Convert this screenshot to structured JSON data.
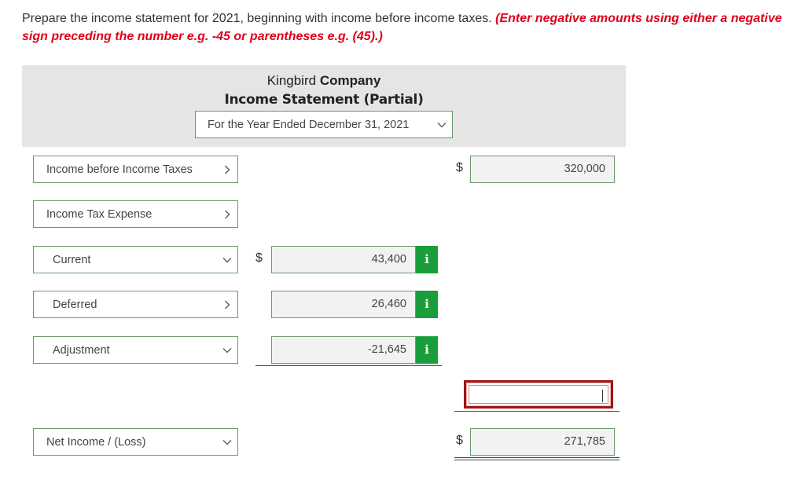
{
  "instructions": {
    "text": "Prepare the income statement for 2021, beginning with income before income taxes. ",
    "note": "(Enter negative amounts using either a negative sign preceding the number e.g. -45 or parentheses e.g. (45).)"
  },
  "header": {
    "company_plain": "Kingbird ",
    "company_bold": "Company",
    "statement_title": "Income Statement (Partial)",
    "period": "For the Year Ended December 31, 2021"
  },
  "rows": {
    "income_before_taxes": {
      "label": "Income before Income Taxes",
      "dollar": "$",
      "amount": "320,000"
    },
    "income_tax_expense": {
      "label": "Income Tax Expense"
    },
    "current": {
      "label": "Current",
      "dollar": "$",
      "amount": "43,400",
      "info": "i"
    },
    "deferred": {
      "label": "Deferred",
      "amount": "26,460",
      "info": "i"
    },
    "adjustment": {
      "label": "Adjustment",
      "amount": "-21,645",
      "info": "i"
    },
    "total_tax": {
      "amount": ""
    },
    "net_income": {
      "label": "Net Income / (Loss)",
      "dollar": "$",
      "amount": "271,785"
    }
  },
  "colors": {
    "accent_green": "#1a9e3c",
    "note_red": "#e0001b",
    "field_border": "#6b9a6b",
    "active_border": "#a01414"
  },
  "icons": {
    "dropdown": "chevron-down-icon",
    "info": "info-icon"
  }
}
